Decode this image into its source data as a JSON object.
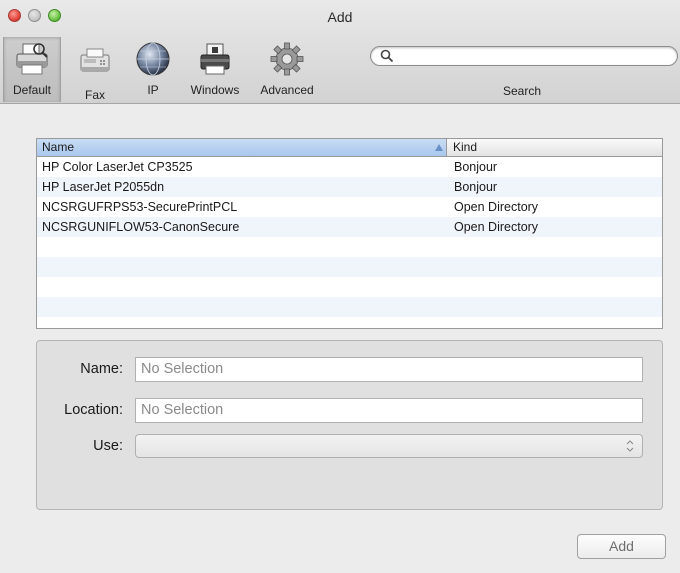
{
  "window": {
    "title": "Add"
  },
  "toolbar": {
    "items": [
      {
        "label": "Default",
        "icon": "printer-icon",
        "selected": true
      },
      {
        "label": "Fax",
        "icon": "fax-icon",
        "selected": false
      },
      {
        "label": "IP",
        "icon": "globe-icon",
        "selected": false
      },
      {
        "label": "Windows",
        "icon": "windows-printer-icon",
        "selected": false
      },
      {
        "label": "Advanced",
        "icon": "gear-icon",
        "selected": false
      }
    ],
    "search": {
      "label": "Search",
      "placeholder": ""
    }
  },
  "printers_table": {
    "columns": [
      "Name",
      "Kind"
    ],
    "rows": [
      {
        "name": "HP Color LaserJet CP3525",
        "kind": "Bonjour"
      },
      {
        "name": "HP LaserJet P2055dn",
        "kind": "Bonjour"
      },
      {
        "name": "NCSRGUFRPS53-SecurePrintPCL",
        "kind": "Open Directory"
      },
      {
        "name": "NCSRGUNIFLOW53-CanonSecure",
        "kind": "Open Directory"
      },
      {
        "name": "",
        "kind": ""
      },
      {
        "name": "",
        "kind": ""
      },
      {
        "name": "",
        "kind": ""
      },
      {
        "name": "",
        "kind": ""
      },
      {
        "name": "",
        "kind": ""
      }
    ]
  },
  "details": {
    "name_label": "Name:",
    "name_value": "No Selection",
    "location_label": "Location:",
    "location_value": "No Selection",
    "use_label": "Use:",
    "use_value": ""
  },
  "footer": {
    "add_label": "Add"
  },
  "colors": {
    "header_selected": "#b3cdef",
    "row_alt": "#f0f4fb",
    "window_bg": "#ececec"
  }
}
